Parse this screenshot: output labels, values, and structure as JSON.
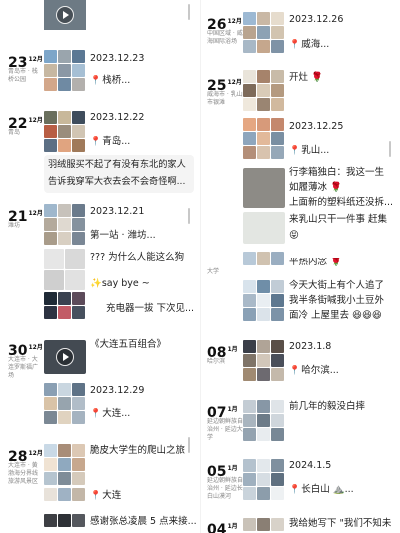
{
  "colors": {
    "accent_pin": "#e34b3a",
    "card_bg": "#f4f4f4",
    "text": "#222222",
    "muted": "#888888"
  },
  "month_suffix": "12月",
  "month_suffix_jan": "1月",
  "left": {
    "e1": {
      "day": "23",
      "loc": "青岛市 · 栈桥公园",
      "date_text": "2023.12.23",
      "place": "栈桥..."
    },
    "e2": {
      "day": "22",
      "loc": "青岛",
      "date_text": "2023.12.22",
      "place": "青岛...",
      "note_line1": "羽绒服买不起了有没有东北的家人",
      "note_line2": "告诉我穿军大衣去会不会奇怪啊..."
    },
    "e3": {
      "day": "21",
      "loc": "潍坊",
      "date_text": "2023.12.21",
      "line1": "第一站 · 潍坊...",
      "line2": "??? 为什么人能这么狗",
      "line3": "✨say bye ~",
      "line4": "充电器一拔 下次见..."
    },
    "e4": {
      "day": "30",
      "loc": "大连市 · 大连罗斯福广场",
      "title": "《大连五百组合》"
    },
    "e5": {
      "date_text": "2023.12.29",
      "place": "大连..."
    },
    "e6": {
      "day": "28",
      "loc": "大连市 · 黄渤海分界线旅游风景区",
      "line1": "脆皮大学生的爬山之旅",
      "place": "大连",
      "line3": "感谢张总凌晨 5 点来接..."
    }
  },
  "right": {
    "e1": {
      "day": "26",
      "loc": "中国区域 · 威海国际浴场",
      "date_text": "2023.12.26",
      "place": "威海..."
    },
    "e2": {
      "day": "25",
      "loc": "威海市 · 乳山市银滩",
      "line1": "开灶 🌹",
      "date_text": "2023.12.25",
      "place": "乳山...",
      "line3": "行李箱独白：我这一生",
      "line4": "如履薄冰 🌹",
      "line5": "上面新的塑料纸还没拆...",
      "line6": "来乳山只干一件事 赶集",
      "line6b": "😝"
    },
    "e3": {
      "loc": "大学",
      "line0": "平热内念 🌹",
      "line1": "今天大街上有个人追了",
      "line2": "我半条街喊我小土豆外",
      "line3": "面冷 上屋里去 😆😆😆"
    },
    "e4": {
      "day": "08",
      "loc": "哈尔滨",
      "date_text": "2023.1.8",
      "place": "哈尔滨..."
    },
    "e5": {
      "day": "07",
      "loc": "延边朝鲜族自治州 · 延边大学",
      "line1": "前几年的毅没白摔"
    },
    "e6": {
      "day": "05",
      "loc": "延边朝鲜族自治州 · 延边长白山漠河",
      "date_text": "2024.1.5",
      "place": "长白山 ⛰️..."
    },
    "e7": {
      "day": "04",
      "line1": "我给她写下 \"我们不知未"
    }
  }
}
